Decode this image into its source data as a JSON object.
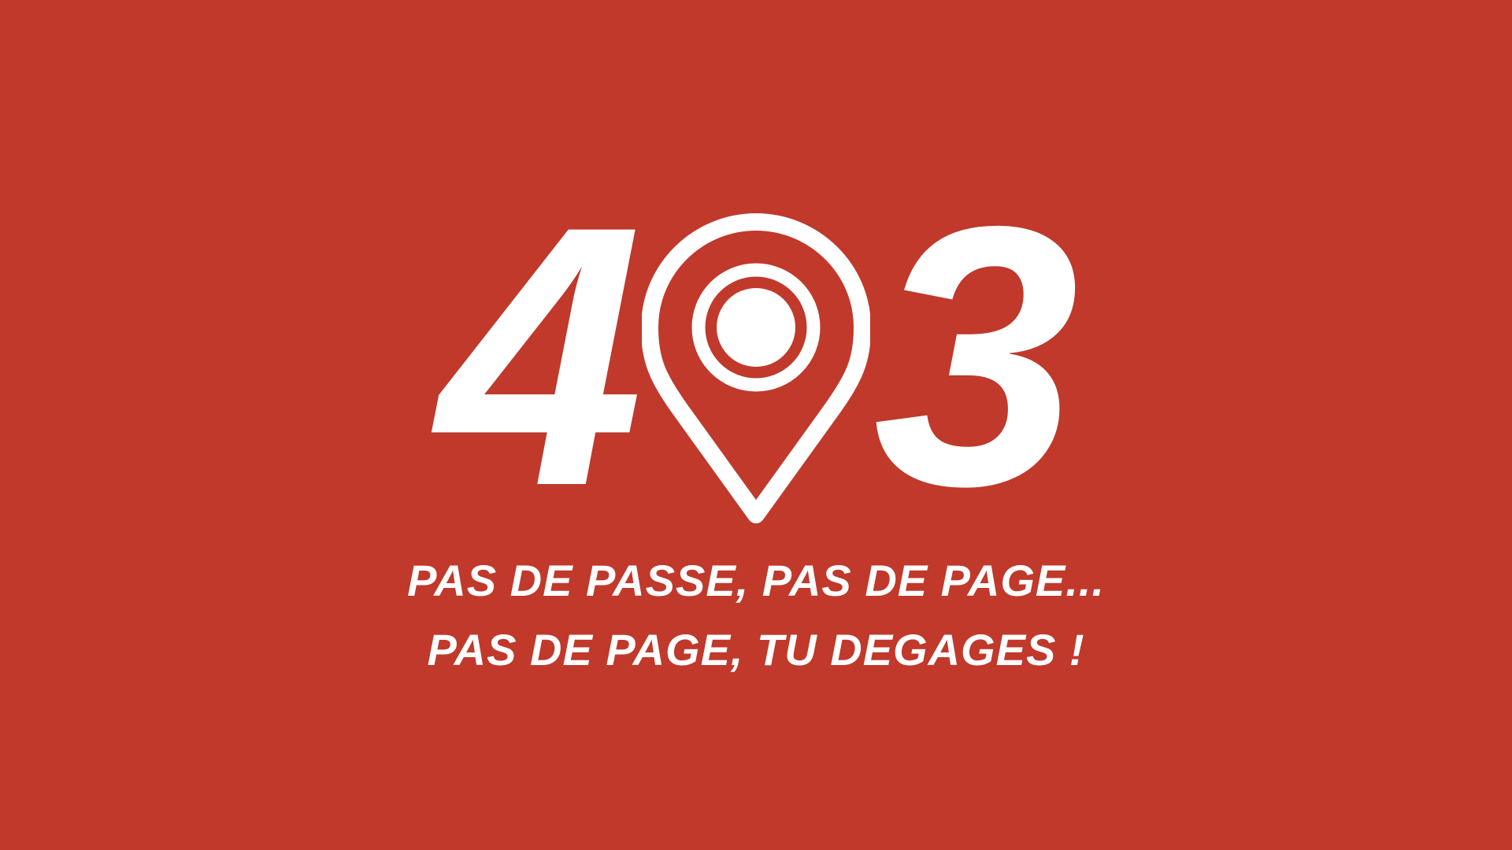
{
  "page": {
    "background_color": "#c0392b",
    "foreground_color": "#ffffff"
  },
  "error": {
    "digit_left": "4",
    "digit_right": "3",
    "middle_icon": "map-pin-icon"
  },
  "message": {
    "line1": "PAS DE PASSE, PAS DE PAGE...",
    "line2": "PAS DE PAGE, TU DEGAGES !"
  }
}
